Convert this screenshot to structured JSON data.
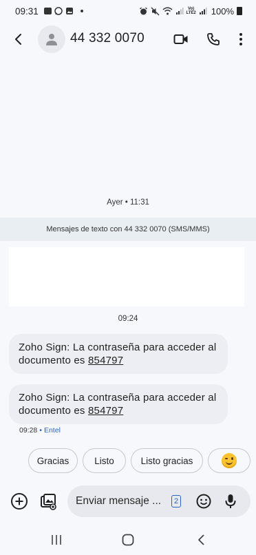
{
  "status_bar": {
    "time": "09:31",
    "battery_percent": "100%",
    "net_label_top": "Vo)",
    "net_label_bottom": "LTE2",
    "left_icons": [
      "outlook-icon",
      "whatsapp-icon",
      "gallery-icon",
      "dot-icon"
    ],
    "right_icons": [
      "alarm-icon",
      "mute-icon",
      "wifi-icon",
      "signal-icon",
      "volte-icon",
      "signal-icon",
      "battery-icon"
    ]
  },
  "header": {
    "contact_title": "44 332 0070",
    "icons": [
      "back-arrow-icon",
      "person-icon",
      "video-call-icon",
      "phone-icon",
      "more-vert-icon"
    ]
  },
  "conversation": {
    "date_separator": "Ayer • 11:31",
    "info_banner": "Mensajes de texto con 44 332 0070 (SMS/MMS)",
    "time_separator": "09:24",
    "messages": [
      {
        "text": "Zoho Sign: La contraseña para acceder al documento es",
        "code": "854797"
      },
      {
        "text": "Zoho Sign: La contraseña para acceder al documento es",
        "code": "854797"
      }
    ],
    "last_meta": {
      "time": "09:28",
      "separator": "•",
      "carrier": "Entel"
    }
  },
  "suggestions": {
    "chips": [
      "Gracias",
      "Listo",
      "Listo gracias"
    ],
    "emoji": "winking-face-emoji"
  },
  "compose": {
    "placeholder": "Enviar mensaje ...",
    "sim_number": "2",
    "icons": [
      "add-circle-icon",
      "gallery-add-icon",
      "sim-icon",
      "emoji-icon",
      "mic-icon"
    ]
  },
  "nav_bar": {
    "icons": [
      "recents-icon",
      "home-icon",
      "back-icon"
    ]
  },
  "colors": {
    "accent": "#2b63c4",
    "background": "#f7f8fb",
    "bubble": "#eceef3",
    "banner": "#e9eef2"
  }
}
